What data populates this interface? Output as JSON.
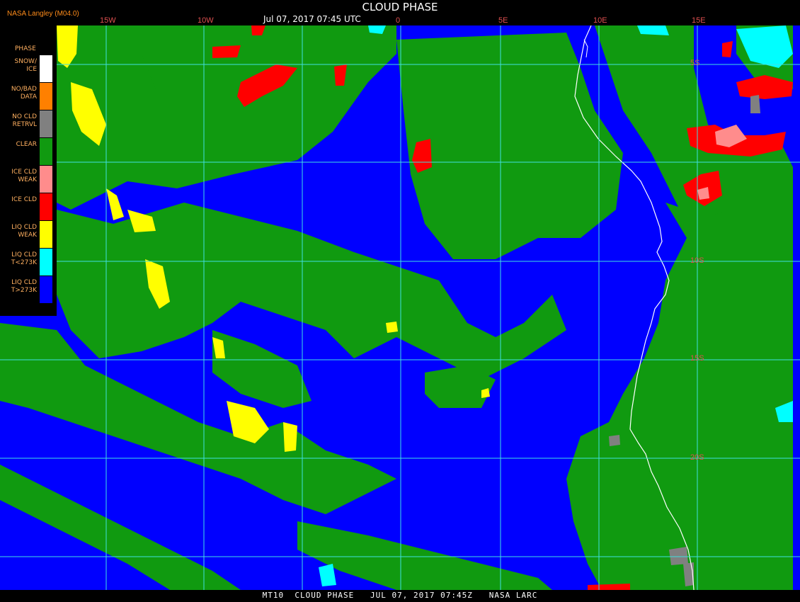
{
  "header": {
    "credit": "NASA Langley (M04.0)",
    "title": "CLOUD PHASE",
    "datetime": "Jul 07, 2017 07:45 UTC"
  },
  "footer": {
    "text": "MT10  CLOUD PHASE   JUL 07, 2017 07:45Z   NASA LARC"
  },
  "grid": {
    "longitude_labels": [
      "15W",
      "10W",
      "0",
      "5E",
      "10E",
      "15E"
    ],
    "latitude_labels": [
      "5S",
      "10S",
      "15S",
      "20S"
    ]
  },
  "legend": {
    "title": "PHASE",
    "items": [
      {
        "label": "SNOW/\nICE",
        "color": "#ffffff"
      },
      {
        "label": "NO/BAD\nDATA",
        "color": "#ff8000"
      },
      {
        "label": "NO CLD\nRETRVL",
        "color": "#808080"
      },
      {
        "label": "CLEAR",
        "color": "#109a10"
      },
      {
        "label": "ICE CLD\nWEAK",
        "color": "#ff8c8c"
      },
      {
        "label": "ICE CLD",
        "color": "#ff0000"
      },
      {
        "label": "LIQ CLD\nWEAK",
        "color": "#ffff00"
      },
      {
        "label": "LIQ CLD\nT<273K",
        "color": "#00ffff"
      },
      {
        "label": "LIQ CLD\nT>273K",
        "color": "#0000ff"
      }
    ]
  },
  "colors": {
    "liquid_warm": "#0000ff",
    "clear": "#109a10",
    "ice": "#ff0000",
    "ice_weak": "#ff8c8c",
    "liquid_weak": "#ffff00",
    "liquid_cold": "#00ffff",
    "no_retrieval": "#808080",
    "snow_ice": "#ffffff",
    "gridline": "#40e0e0",
    "label_red": "#e05050"
  }
}
